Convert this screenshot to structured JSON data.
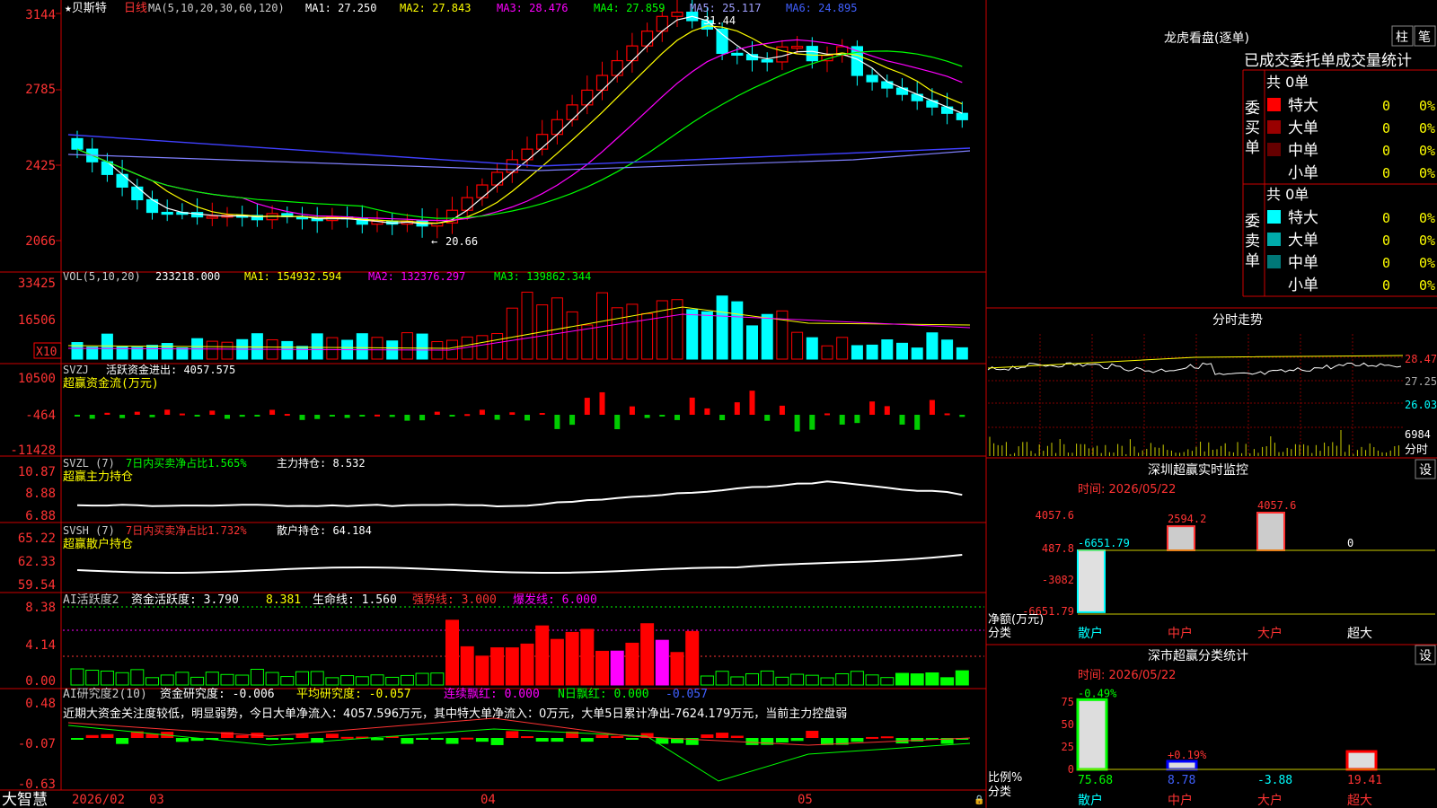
{
  "brand": "大智慧",
  "stock": {
    "name": "★贝斯特",
    "period": "日线"
  },
  "price_legend": {
    "ma_title": "MA(5,10,20,30,60,120)",
    "ma1": "MA1: 27.250",
    "ma2": "MA2: 27.843",
    "ma3": "MA3: 28.476",
    "ma4": "MA4: 27.859",
    "ma5": "MA5: 25.117",
    "ma6": "MA6: 24.895",
    "high_mark": "31.44",
    "low_mark": "20.66"
  },
  "price_axis": [
    "3144",
    "2785",
    "2425",
    "2066"
  ],
  "vol_legend": {
    "title": "VOL(5,10,20)",
    "value": "233218.000",
    "ma1": "MA1: 154932.594",
    "ma2": "MA2: 132376.297",
    "ma3": "MA3: 139862.344",
    "unit": "X10"
  },
  "vol_axis": [
    "33425",
    "16506"
  ],
  "svzj": {
    "name": "SVZJ",
    "label": "活跃资金进出: 4057.575",
    "sub": "超赢资金流(万元)",
    "axis": [
      "10500",
      "-464",
      "-11428"
    ]
  },
  "svzl": {
    "name": "SVZL (7)",
    "label1": "7日内买卖净占比1.565%",
    "label2": "主力持仓: 8.532",
    "sub": "超赢主力持仓",
    "axis": [
      "10.87",
      "8.88",
      "6.88"
    ]
  },
  "svsh": {
    "name": "SVSH (7)",
    "label1": "7日内买卖净占比1.732%",
    "label2": "散户持仓: 64.184",
    "sub": "超赢散户持仓",
    "axis": [
      "65.22",
      "62.33",
      "59.54"
    ]
  },
  "ai_act": {
    "name": "AI活跃度2",
    "a": "资金活跃度: 3.790",
    "b": "8.381",
    "c": "生命线: 1.560",
    "d": "强势线: 3.000",
    "e": "爆发线: 6.000",
    "axis": [
      "8.38",
      "4.14",
      "0.00"
    ]
  },
  "ai_res": {
    "name": "AI研究度2(10)",
    "a": "资金研究度: -0.006",
    "b": "平均研究度: -0.057",
    "c": "连续飘红: 0.000",
    "d": "N日飘红: 0.000",
    "e": "-0.057",
    "note": "近期大资金关注度较低，明显弱势，今日大单净流入：4057.596万元，其中特大单净流入：0万元，大单5日累计净出-7624.179万元，当前主力控盘弱",
    "axis": [
      "0.48",
      "-0.07",
      "-0.63"
    ]
  },
  "date_axis": [
    "2026/02",
    "03",
    "04",
    "05"
  ],
  "dragon": {
    "title": "龙虎看盘(逐单)",
    "btn_zhu": "柱",
    "btn_bi": "笔",
    "tabs": "已成交委托单成交量统计",
    "buy_label": "委买单",
    "sell_label": "委卖单",
    "buy_total": "共 0单",
    "sell_total": "共 0单",
    "buy_rows": [
      {
        "name": "特大",
        "count": "0",
        "pct": "0%",
        "color": "#ff0000"
      },
      {
        "name": "大单",
        "count": "0",
        "pct": "0%",
        "color": "#990000"
      },
      {
        "name": "中单",
        "count": "0",
        "pct": "0%",
        "color": "#660000"
      },
      {
        "name": "小单",
        "count": "0",
        "pct": "0%",
        "color": ""
      }
    ],
    "sell_rows": [
      {
        "name": "特大",
        "count": "0",
        "pct": "0%",
        "color": "#00ffff"
      },
      {
        "name": "大单",
        "count": "0",
        "pct": "0%",
        "color": "#00aaaa"
      },
      {
        "name": "中单",
        "count": "0",
        "pct": "0%",
        "color": "#007777"
      },
      {
        "name": "小单",
        "count": "0",
        "pct": "0%",
        "color": ""
      }
    ]
  },
  "intraday": {
    "title": "分时走势",
    "axis": [
      "28.47",
      "27.25",
      "26.03"
    ],
    "vol_top": "6984",
    "vol_label": "分时"
  },
  "sz_monitor": {
    "title": "深圳超赢实时监控",
    "set": "设",
    "time": "时间: 2026/05/22",
    "axis": [
      "4057.6",
      "487.8",
      "-3082",
      "-6651.79"
    ],
    "ylabel": "净额(万元)",
    "xlabel": "分类",
    "cats": [
      "散户",
      "中户",
      "大户",
      "超大"
    ],
    "bars": [
      {
        "value": -6651.79,
        "label": "-6651.79"
      },
      {
        "value": 2594.2,
        "label": "2594.2"
      },
      {
        "value": 4057.6,
        "label": "4057.6"
      },
      {
        "value": 0,
        "label": "0"
      }
    ]
  },
  "sz_class": {
    "title": "深市超赢分类统计",
    "set": "设",
    "time": "时间: 2026/05/22",
    "axis": [
      "75",
      "50",
      "25",
      "0"
    ],
    "ylabel": "比例%",
    "xlabel": "分类",
    "cats": [
      "散户",
      "中户",
      "大户",
      "超大"
    ],
    "bars": [
      {
        "value": 75.68,
        "label": "75.68",
        "top": "-0.49%"
      },
      {
        "value": 8.78,
        "label": "8.78",
        "top": "+0.19%"
      },
      {
        "value": -3.88,
        "label": "-3.88",
        "top": ""
      },
      {
        "value": 19.41,
        "label": "19.41",
        "top": ""
      }
    ]
  },
  "colors": {
    "up": "#ff0000",
    "down": "#00ffff",
    "ma1": "#ffffff",
    "ma2": "#ffff00",
    "ma3": "#ff00ff",
    "ma4": "#00ff00",
    "ma5": "#8080ff",
    "ma6": "#4040ff",
    "axis": "#ff0000",
    "grid": "#800000"
  }
}
